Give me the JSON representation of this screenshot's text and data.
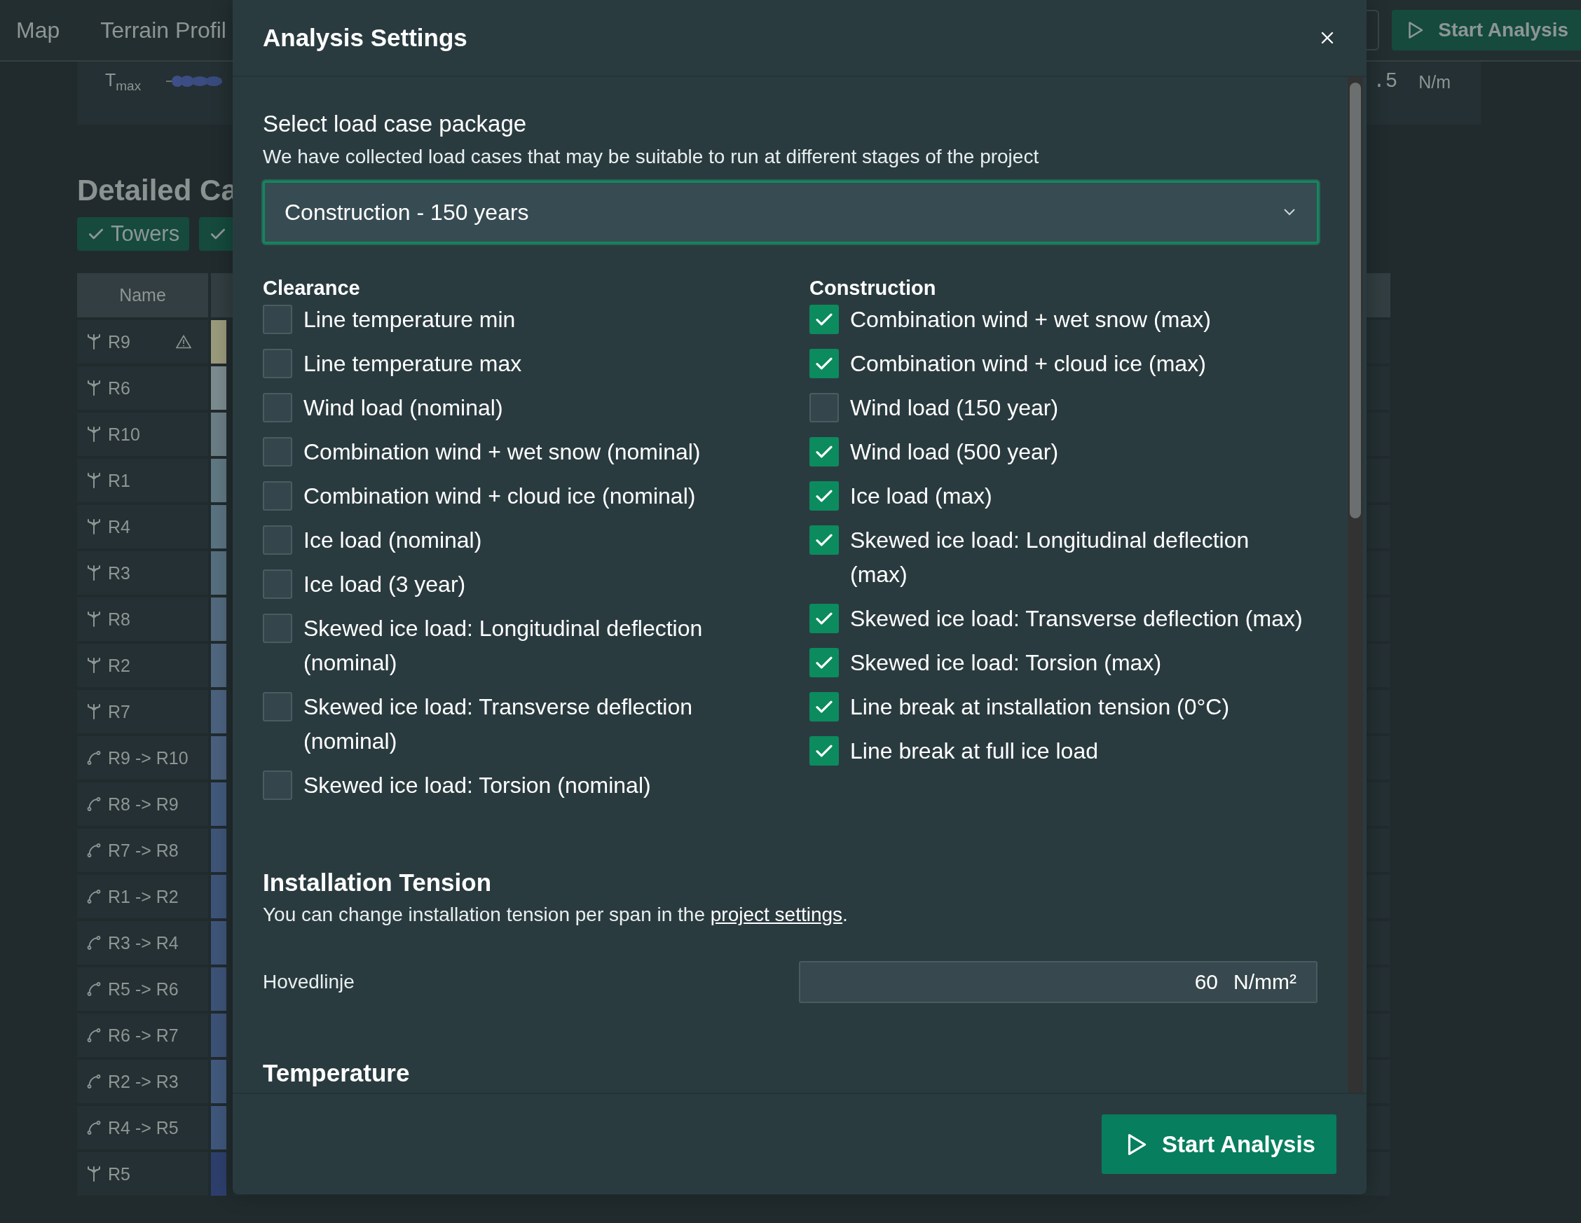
{
  "nav": {
    "tabs": [
      {
        "label": "Map"
      },
      {
        "label": "Terrain Profil"
      }
    ],
    "start_button": "Start Analysis"
  },
  "summary": {
    "label": "T$_{max}$",
    "value": ".5",
    "unit": "N/m"
  },
  "section": {
    "title": "Detailed Ca",
    "filters": [
      {
        "label": "Towers",
        "checked": true
      },
      {
        "checked": true
      }
    ]
  },
  "table": {
    "columns": [
      "Name"
    ],
    "rows": [
      {
        "name": "R9",
        "kind": "tower",
        "warning": true,
        "color": "#9a9a7c"
      },
      {
        "name": "R6",
        "kind": "tower",
        "warning": false,
        "color": "#7b8b8f"
      },
      {
        "name": "R10",
        "kind": "tower",
        "warning": false,
        "color": "#6b7d85"
      },
      {
        "name": "R1",
        "kind": "tower",
        "warning": false,
        "color": "#607882"
      },
      {
        "name": "R4",
        "kind": "tower",
        "warning": false,
        "color": "#5a7381"
      },
      {
        "name": "R3",
        "kind": "tower",
        "warning": false,
        "color": "#566f7e"
      },
      {
        "name": "R8",
        "kind": "tower",
        "warning": false,
        "color": "#52697d"
      },
      {
        "name": "R2",
        "kind": "tower",
        "warning": false,
        "color": "#4f677f"
      },
      {
        "name": "R7",
        "kind": "tower",
        "warning": false,
        "color": "#4b627f"
      },
      {
        "name": "R9 -> R10",
        "kind": "span",
        "warning": false,
        "color": "#4a607e"
      },
      {
        "name": "R8 -> R9",
        "kind": "span",
        "warning": false,
        "color": "#41597b"
      },
      {
        "name": "R7 -> R8",
        "kind": "span",
        "warning": false,
        "color": "#3f5578"
      },
      {
        "name": "R1 -> R2",
        "kind": "span",
        "warning": false,
        "color": "#3d5478"
      },
      {
        "name": "R3 -> R4",
        "kind": "span",
        "warning": false,
        "color": "#3e5579"
      },
      {
        "name": "R5 -> R6",
        "kind": "span",
        "warning": false,
        "color": "#3d5377"
      },
      {
        "name": "R6 -> R7",
        "kind": "span",
        "warning": false,
        "color": "#3c5276"
      },
      {
        "name": "R2 -> R3",
        "kind": "span",
        "warning": false,
        "color": "#41597c"
      },
      {
        "name": "R4 -> R5",
        "kind": "span",
        "warning": false,
        "color": "#3f577b"
      },
      {
        "name": "R5",
        "kind": "tower",
        "warning": false,
        "color": "#2e3f6d"
      }
    ]
  },
  "dialog": {
    "title": "Analysis Settings",
    "package": {
      "label": "Select load case package",
      "description": "We have collected load cases that may be suitable to run at different stages of the project",
      "value": "Construction - 150 years"
    },
    "groups": [
      {
        "title": "Clearance",
        "items": [
          {
            "label": "Line temperature min",
            "checked": false
          },
          {
            "label": "Line temperature max",
            "checked": false
          },
          {
            "label": "Wind load (nominal)",
            "checked": false
          },
          {
            "label": "Combination wind + wet snow (nominal)",
            "checked": false
          },
          {
            "label": "Combination wind + cloud ice (nominal)",
            "checked": false
          },
          {
            "label": "Ice load (nominal)",
            "checked": false
          },
          {
            "label": "Ice load (3 year)",
            "checked": false
          },
          {
            "label": "Skewed ice load: Longitudinal deflection (nominal)",
            "checked": false
          },
          {
            "label": "Skewed ice load: Transverse deflection (nominal)",
            "checked": false
          },
          {
            "label": "Skewed ice load: Torsion (nominal)",
            "checked": false
          }
        ]
      },
      {
        "title": "Construction",
        "items": [
          {
            "label": "Combination wind + wet snow (max)",
            "checked": true
          },
          {
            "label": "Combination wind + cloud ice (max)",
            "checked": true
          },
          {
            "label": "Wind load (150 year)",
            "checked": false
          },
          {
            "label": "Wind load (500 year)",
            "checked": true
          },
          {
            "label": "Ice load (max)",
            "checked": true
          },
          {
            "label": "Skewed ice load: Longitudinal deflection (max)",
            "checked": true
          },
          {
            "label": "Skewed ice load: Transverse deflection (max)",
            "checked": true
          },
          {
            "label": "Skewed ice load: Torsion (max)",
            "checked": true
          },
          {
            "label": "Line break at installation tension (0°C)",
            "checked": true
          },
          {
            "label": "Line break at full ice load",
            "checked": true
          }
        ]
      }
    ],
    "installation": {
      "title": "Installation Tension",
      "text": "You can change installation tension per span in the",
      "link": "project settings",
      "text_end": ".",
      "lines": [
        {
          "label": "Hovedlinje",
          "value": "60",
          "unit": "N/mm²"
        }
      ]
    },
    "next_section": "Temperature",
    "action": "Start Analysis"
  }
}
